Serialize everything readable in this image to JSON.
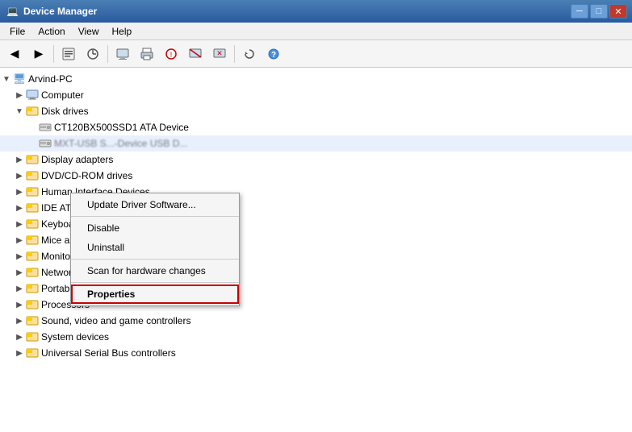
{
  "titleBar": {
    "title": "Device Manager",
    "icon": "💻",
    "buttons": {
      "minimize": "─",
      "maximize": "□",
      "close": "✕"
    }
  },
  "menuBar": {
    "items": [
      "File",
      "Action",
      "View",
      "Help"
    ]
  },
  "toolbar": {
    "buttons": [
      "◀",
      "▶",
      "⊙",
      "📋",
      "🔍",
      "💻",
      "🖨",
      "⚡",
      "🔧",
      "❌",
      "🔄"
    ]
  },
  "tree": {
    "items": [
      {
        "level": 0,
        "expanded": true,
        "label": "Arvind-PC",
        "icon": "computer"
      },
      {
        "level": 1,
        "expanded": false,
        "label": "Computer",
        "icon": "folder"
      },
      {
        "level": 1,
        "expanded": true,
        "label": "Disk drives",
        "icon": "folder"
      },
      {
        "level": 2,
        "expanded": false,
        "label": "CT120BX500SSD1 ATA Device",
        "icon": "hdd"
      },
      {
        "level": 2,
        "expanded": false,
        "label": "MXT-USB S...-Device USB D...",
        "icon": "hdd",
        "blurred": true
      },
      {
        "level": 1,
        "expanded": false,
        "label": "Display adapters",
        "icon": "folder"
      },
      {
        "level": 1,
        "expanded": false,
        "label": "DVD/CD-ROM drives",
        "icon": "folder"
      },
      {
        "level": 1,
        "expanded": false,
        "label": "Human Interface Devices",
        "icon": "folder"
      },
      {
        "level": 1,
        "expanded": false,
        "label": "IDE ATA/ATAPI controllers",
        "icon": "folder"
      },
      {
        "level": 1,
        "expanded": false,
        "label": "Keyboards",
        "icon": "folder"
      },
      {
        "level": 1,
        "expanded": false,
        "label": "Mice and other pointing devices",
        "icon": "folder"
      },
      {
        "level": 1,
        "expanded": false,
        "label": "Monitors",
        "icon": "folder"
      },
      {
        "level": 1,
        "expanded": false,
        "label": "Network adapters",
        "icon": "folder"
      },
      {
        "level": 1,
        "expanded": false,
        "label": "Portable Devices",
        "icon": "folder"
      },
      {
        "level": 1,
        "expanded": false,
        "label": "Processors",
        "icon": "folder"
      },
      {
        "level": 1,
        "expanded": false,
        "label": "Sound, video and game controllers",
        "icon": "folder"
      },
      {
        "level": 1,
        "expanded": false,
        "label": "System devices",
        "icon": "folder"
      },
      {
        "level": 1,
        "expanded": false,
        "label": "Universal Serial Bus controllers",
        "icon": "folder"
      }
    ]
  },
  "contextMenu": {
    "items": [
      {
        "label": "Update Driver Software...",
        "type": "item"
      },
      {
        "type": "separator"
      },
      {
        "label": "Disable",
        "type": "item"
      },
      {
        "label": "Uninstall",
        "type": "item"
      },
      {
        "type": "separator"
      },
      {
        "label": "Scan for hardware changes",
        "type": "item"
      },
      {
        "type": "separator"
      },
      {
        "label": "Properties",
        "type": "item",
        "highlighted": true
      }
    ]
  }
}
